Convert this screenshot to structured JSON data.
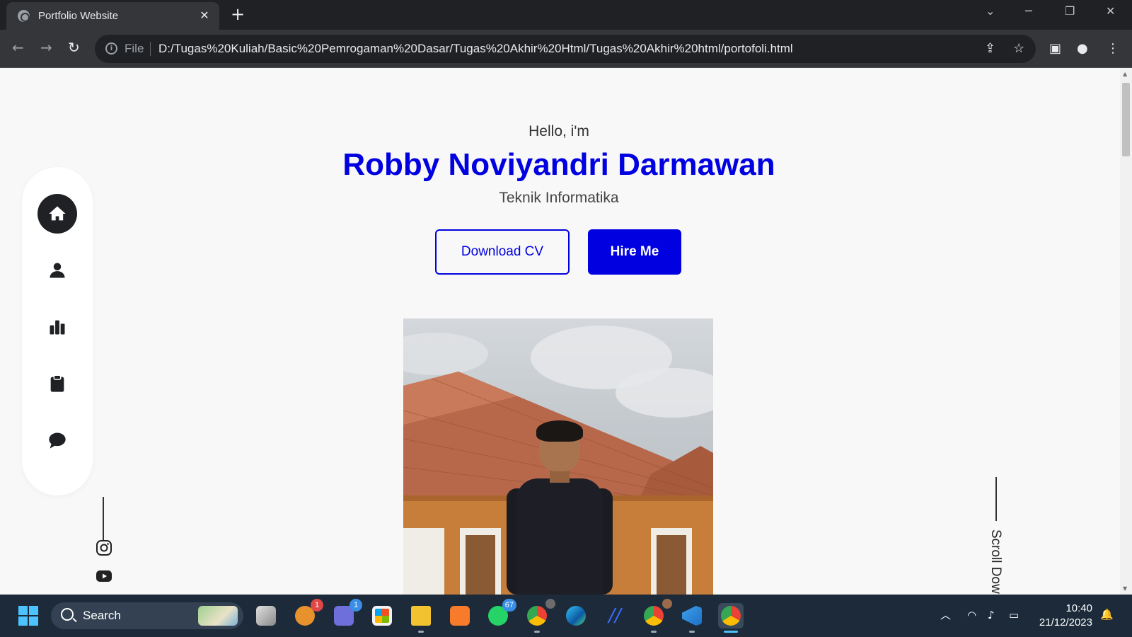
{
  "browser": {
    "tab_title": "Portfolio Website",
    "tab_close": "✕",
    "new_tab": "+",
    "file_label": "File",
    "url": "D:/Tugas%20Kuliah/Basic%20Pemrogaman%20Dasar/Tugas%20Akhir%20Html/Tugas%20Akhir%20html/portofoli.html"
  },
  "hero": {
    "greeting": "Hello, i'm",
    "name": "Robby Noviyandri Darmawan",
    "title": "Teknik Informatika",
    "download_cv_label": "Download CV",
    "hire_me_label": "Hire Me",
    "scroll_label": "Scroll Down"
  },
  "sidenav": {
    "items": [
      {
        "icon": "home-icon",
        "active": true
      },
      {
        "icon": "user-icon",
        "active": false
      },
      {
        "icon": "chart-icon",
        "active": false
      },
      {
        "icon": "clipboard-icon",
        "active": false
      },
      {
        "icon": "chat-icon",
        "active": false
      }
    ],
    "socials": [
      "instagram-icon",
      "youtube-icon"
    ]
  },
  "colors": {
    "accent": "#0000e0",
    "dark": "#202124",
    "page_bg": "#f8f8f8"
  },
  "taskbar": {
    "search_label": "Search",
    "badges": {
      "app1": "1",
      "teams": "1",
      "whatsapp": "67"
    },
    "time": "10:40",
    "date": "21/12/2023"
  }
}
